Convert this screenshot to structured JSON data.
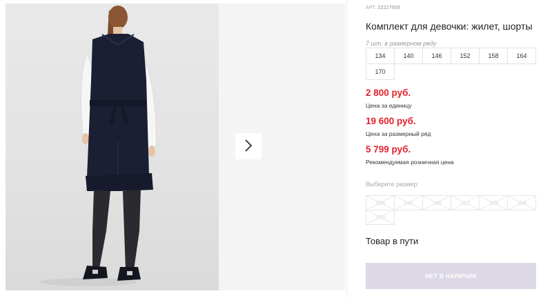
{
  "gallery": {
    "main_photo_alt": "",
    "next_icon": "chevron-right-icon"
  },
  "product": {
    "sku_prefix": "АРТ.",
    "sku": "22227009",
    "title": "Комплект для девочки: жилет, шорты",
    "qty_note": "7 шт. в размерном ряду",
    "size_rows": [
      [
        "134",
        "140",
        "146",
        "152",
        "158",
        "164"
      ],
      [
        "170"
      ]
    ],
    "prices": [
      {
        "value": "2 800 руб.",
        "label": "Цена за единицу"
      },
      {
        "value": "19 600 руб.",
        "label": "Цена за размерный ряд"
      },
      {
        "value": "5 799 руб.",
        "label": "Рекомендуемая розничная цена"
      }
    ],
    "choose_size_label": "Выберите размер:",
    "status": "Товар в пути",
    "oos_button": "НЕТ В НАЛИЧИИ"
  },
  "colors": {
    "price": "#e5212c",
    "button_disabled": "#ddd8e6",
    "photo_bg": "#e4e4e4"
  }
}
